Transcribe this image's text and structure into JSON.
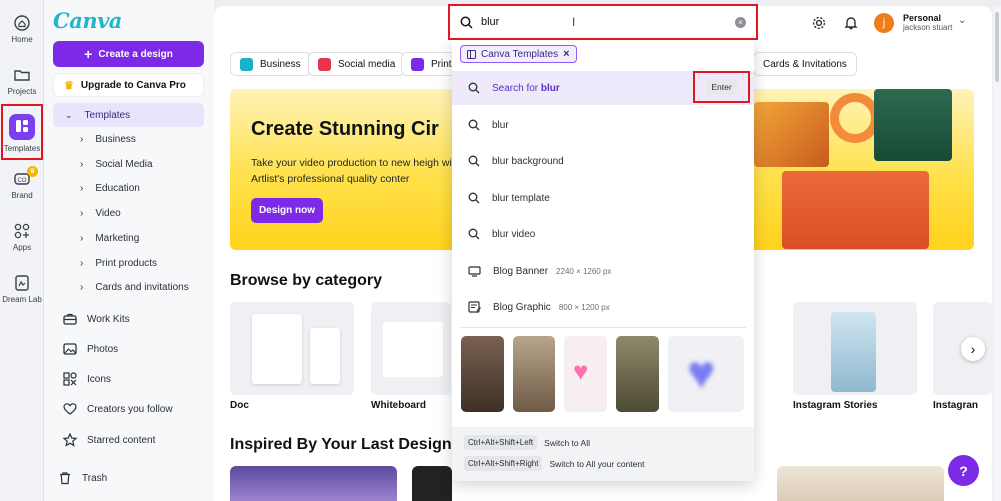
{
  "rail": {
    "items": [
      {
        "label": "Home",
        "icon": "home-icon"
      },
      {
        "label": "Projects",
        "icon": "folder-icon"
      },
      {
        "label": "Templates",
        "icon": "templates-icon"
      },
      {
        "label": "Brand",
        "icon": "brand-icon"
      },
      {
        "label": "Apps",
        "icon": "apps-icon"
      },
      {
        "label": "Dream Lab",
        "icon": "dream-lab-icon"
      }
    ]
  },
  "panel": {
    "logo": "Canva",
    "create_label": "Create a design",
    "upgrade_label": "Upgrade to Canva Pro",
    "templates_label": "Templates",
    "template_subs": [
      "Business",
      "Social Media",
      "Education",
      "Video",
      "Marketing",
      "Print products",
      "Cards and invitations"
    ],
    "nav": [
      {
        "label": "Work Kits",
        "icon": "briefcase-icon"
      },
      {
        "label": "Photos",
        "icon": "photo-icon"
      },
      {
        "label": "Icons",
        "icon": "shapes-icon"
      },
      {
        "label": "Creators you follow",
        "icon": "heart-icon"
      },
      {
        "label": "Starred content",
        "icon": "star-icon"
      },
      {
        "label": "Trash",
        "icon": "trash-icon"
      }
    ]
  },
  "header": {
    "account_type": "Personal",
    "user_name": "jackson stuart",
    "avatar_initial": "j"
  },
  "search": {
    "value": "blur",
    "filter_label": "Canva Templates",
    "suggestions": [
      {
        "prefix": "Search for ",
        "term": "blur",
        "hint": "Enter",
        "icon": "search-icon"
      },
      {
        "text": "blur",
        "icon": "search-icon"
      },
      {
        "text": "blur background",
        "icon": "search-icon"
      },
      {
        "text": "blur template",
        "icon": "search-icon"
      },
      {
        "text": "blur video",
        "icon": "search-icon"
      },
      {
        "text": "Blog Banner",
        "dims": "2240 × 1260 px",
        "icon": "banner-icon"
      },
      {
        "text": "Blog Graphic",
        "dims": "800 × 1200 px",
        "icon": "graphic-icon"
      }
    ],
    "shortcuts": [
      {
        "keys": "Ctrl+Alt+Shift+Left",
        "desc": "Switch to All"
      },
      {
        "keys": "Ctrl+Alt+Shift+Right",
        "desc": "Switch to All your content"
      }
    ]
  },
  "chips": [
    {
      "label": "Business",
      "color": "#1ab0c8"
    },
    {
      "label": "Social media",
      "color": "#e8344d"
    },
    {
      "label": "Print",
      "color": "#7d2ae8"
    },
    {
      "label": "Cards & Invitations",
      "color": ""
    }
  ],
  "hero": {
    "title": "Create Stunning Cir",
    "subtitle": "Take your video production to new heigh with Artlist's professional quality conter",
    "button": "Design now"
  },
  "sections": {
    "browse": "Browse by category",
    "inspired": "Inspired By Your Last Design"
  },
  "categories": [
    {
      "label": "Doc"
    },
    {
      "label": "Whiteboard"
    },
    {
      "label": "Instagram Stories"
    },
    {
      "label": "Instagran"
    }
  ],
  "colors": {
    "accent": "#7d2ae8",
    "highlight": "#e0171e"
  }
}
